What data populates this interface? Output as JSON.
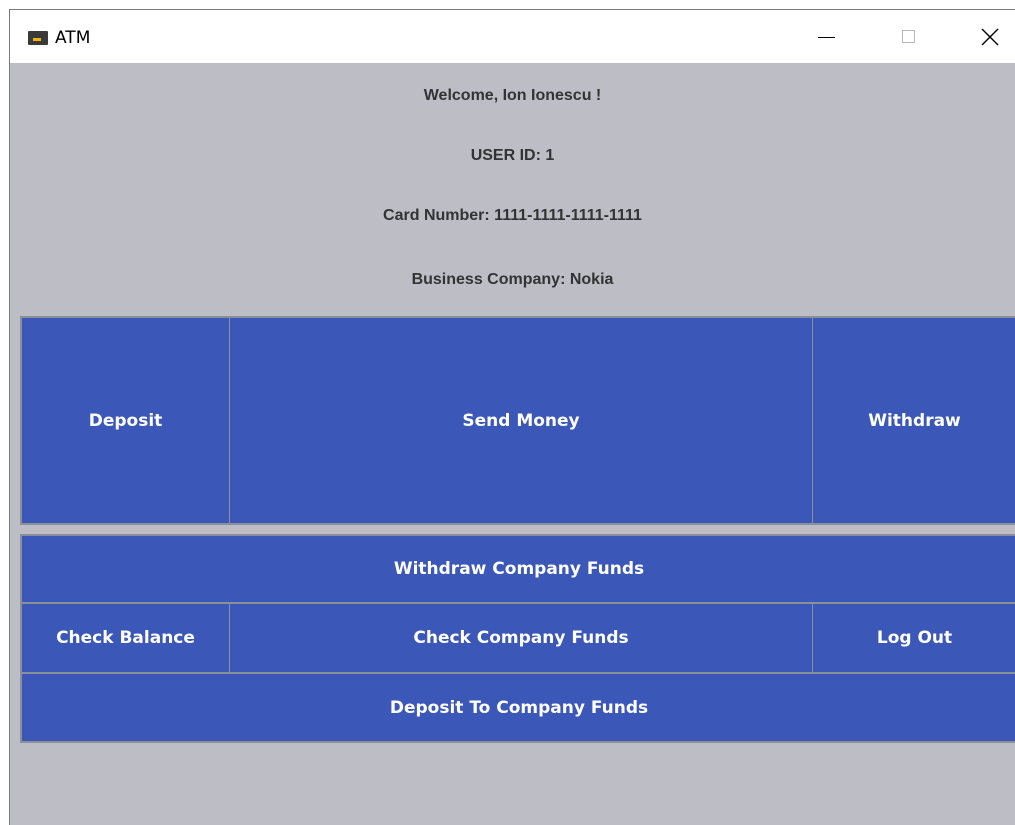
{
  "window": {
    "title": "ATM",
    "icon": "credit-card-icon",
    "controls": [
      "minimize-icon",
      "maximize-icon",
      "close-icon"
    ]
  },
  "info": {
    "welcome": "Welcome, Ion Ionescu !",
    "user_id": "USER ID: 1",
    "card_number": "Card Number: 1111-1111-1111-1111",
    "business_company": "Business Company: Nokia"
  },
  "buttons": {
    "deposit": "Deposit",
    "send_money": "Send Money",
    "withdraw": "Withdraw",
    "withdraw_company_funds": "Withdraw Company Funds",
    "check_balance": "Check Balance",
    "check_company_funds": "Check Company Funds",
    "log_out": "Log Out",
    "deposit_to_company_funds": "Deposit To Company Funds"
  },
  "colors": {
    "background": "#bdbdc6",
    "button": "#3b57b8",
    "button_text": "#ffffff",
    "border": "#8a8f9a",
    "info_text": "#333333"
  }
}
